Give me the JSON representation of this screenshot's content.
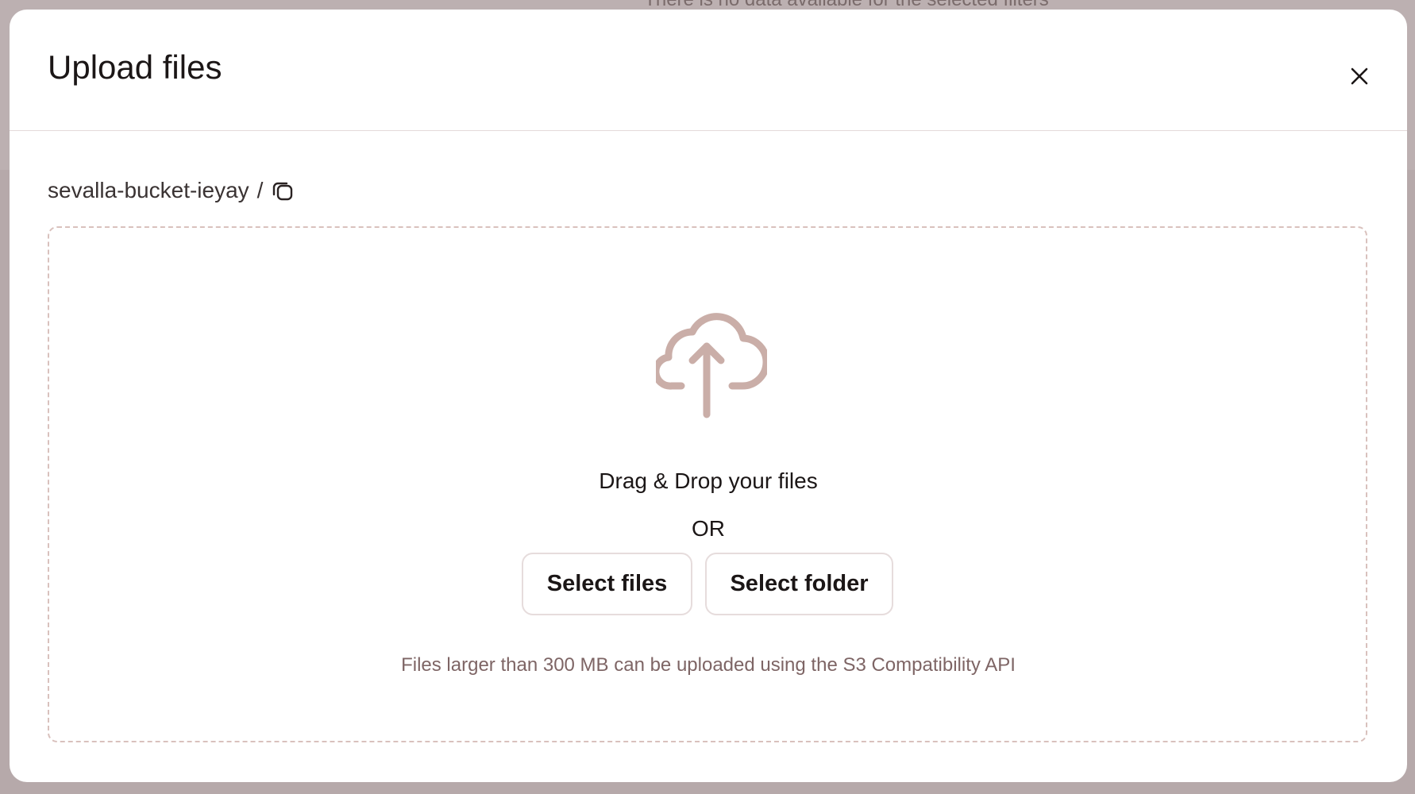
{
  "background": {
    "message": "There is no data available for the selected filters"
  },
  "modal": {
    "title": "Upload files",
    "close_icon": "close-icon"
  },
  "breadcrumb": {
    "bucket": "sevalla-bucket-ieyay",
    "separator": "/",
    "copy_icon": "copy-icon"
  },
  "dropzone": {
    "icon": "cloud-upload-icon",
    "drag_text": "Drag & Drop your files",
    "or_text": "OR",
    "select_files_label": "Select files",
    "select_folder_label": "Select folder",
    "hint": "Files larger than 300 MB can be uploaded using the S3 Compatibility API"
  },
  "colors": {
    "backdrop": "#b6a9aa",
    "accent_icon": "#caaea8",
    "dropzone_border": "#d9c1bd",
    "hint_text": "#7e6565"
  }
}
